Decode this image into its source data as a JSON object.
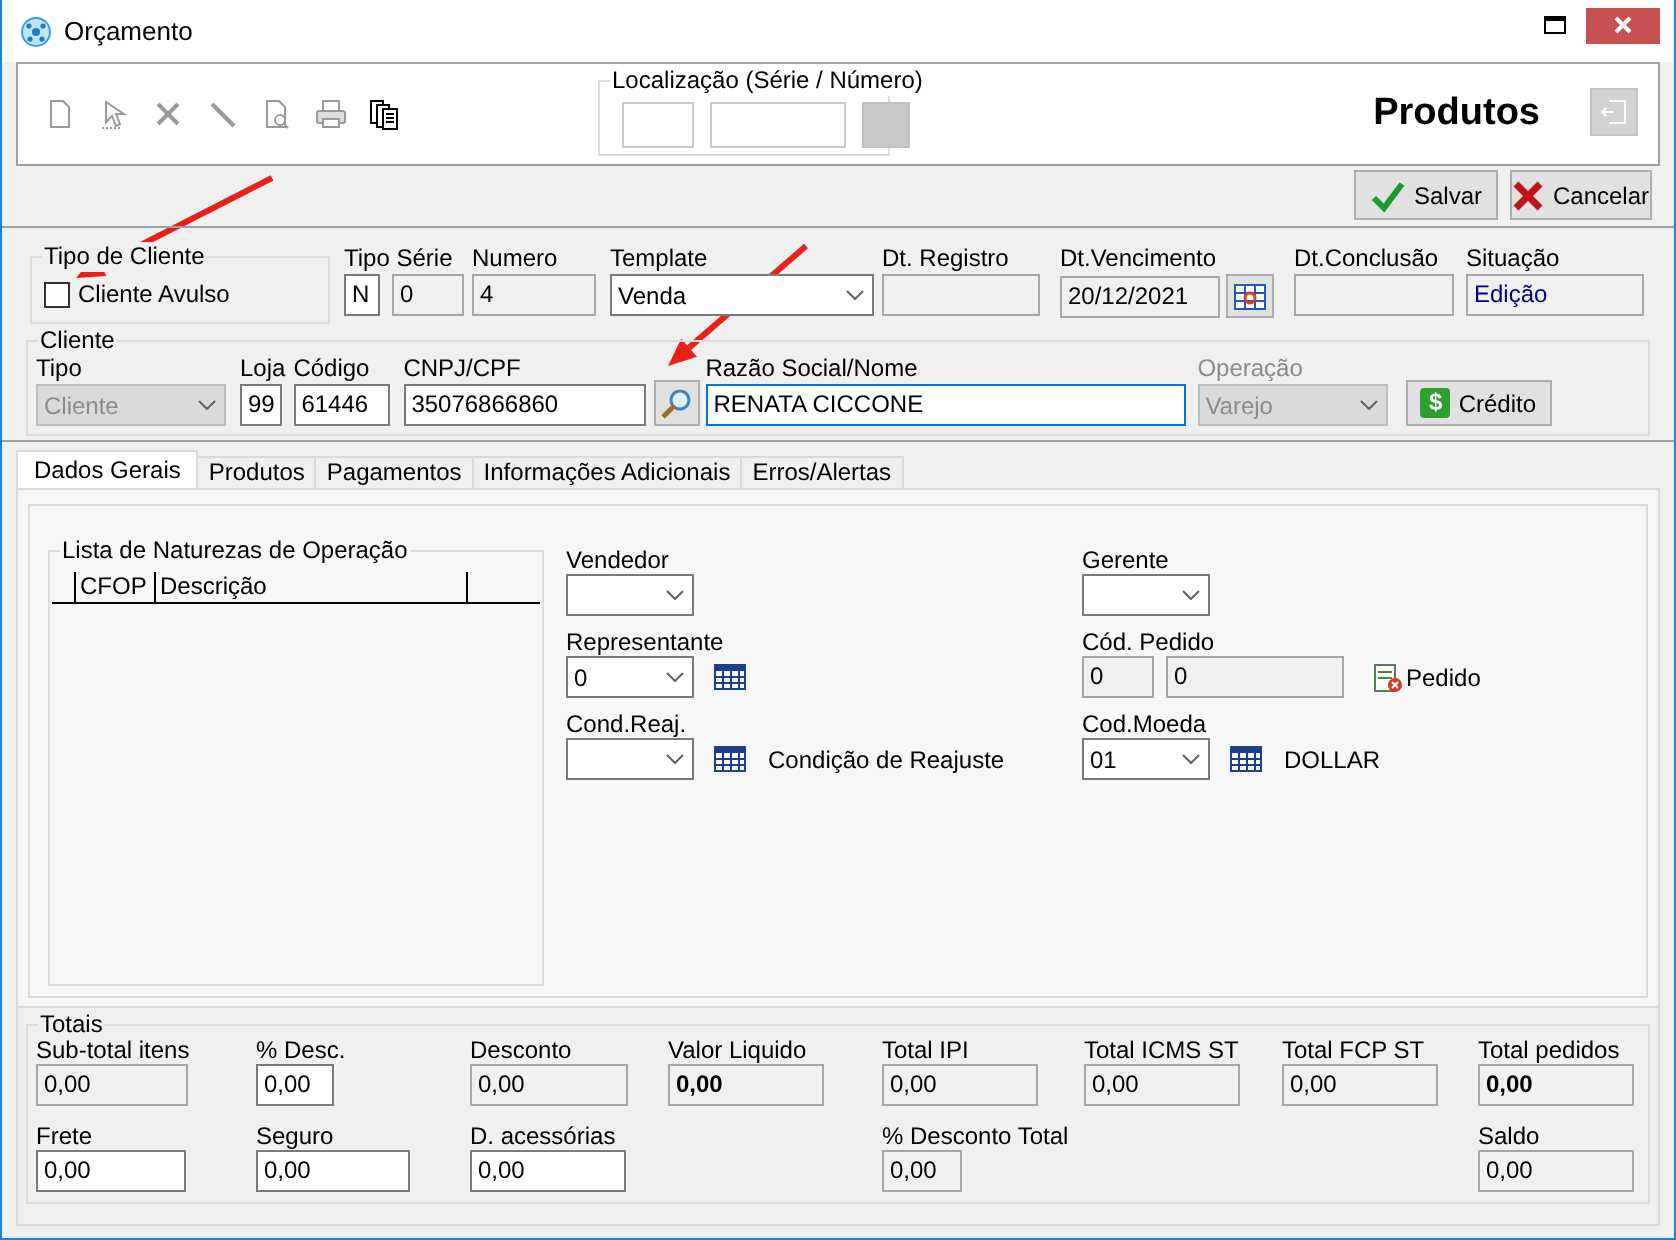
{
  "window": {
    "title": "Orçamento"
  },
  "toolbar": {
    "location_label": "Localização (Série / Número)",
    "screen_title": "Produtos"
  },
  "actions": [
    {
      "kind": "save",
      "label": "Salvar"
    },
    {
      "kind": "cancel",
      "label": "Cancelar"
    }
  ],
  "client_type": {
    "title": "Tipo de Cliente",
    "label": "Cliente Avulso",
    "checked": false
  },
  "header_fields": [
    {
      "label": "Tipo Série",
      "kind": "text",
      "inputs": [
        {
          "value": "N",
          "readonly": false
        },
        {
          "value": "0",
          "readonly": true
        }
      ]
    },
    {
      "label": "Numero",
      "kind": "text",
      "inputs": [
        {
          "value": "4",
          "readonly": true
        }
      ]
    },
    {
      "label": "Template",
      "kind": "combo",
      "inputs": [
        {
          "value": "Venda",
          "disabled": false
        }
      ]
    },
    {
      "label": "Dt. Registro",
      "kind": "text",
      "inputs": [
        {
          "readonly": true
        }
      ]
    },
    {
      "label": "Dt.Vencimento",
      "kind": "date",
      "inputs": [
        {
          "value": "20/12/2021",
          "readonly": true
        }
      ]
    },
    {
      "label": "Dt.Conclusão",
      "kind": "text",
      "inputs": [
        {
          "readonly": true
        }
      ]
    },
    {
      "label": "Situação",
      "kind": "status",
      "inputs": [
        {
          "value": "Edição",
          "readonly": true
        }
      ]
    }
  ],
  "client": {
    "title": "Cliente",
    "fields": [
      {
        "label": "Tipo",
        "kind": "combo",
        "inputs": [
          {
            "value": "Cliente",
            "disabled": true
          }
        ]
      },
      {
        "label": "Loja",
        "kind": "text",
        "inputs": [
          {
            "value": "99",
            "readonly": false
          }
        ]
      },
      {
        "label": "Código",
        "kind": "text",
        "inputs": [
          {
            "value": "61446",
            "readonly": false
          }
        ]
      },
      {
        "label": "CNPJ/CPF",
        "kind": "text",
        "inputs": [
          {
            "value": "35076866860",
            "readonly": false
          }
        ]
      },
      {
        "kind": "search_button"
      },
      {
        "label": "Razão Social/Nome",
        "kind": "text",
        "inputs": [
          {
            "value": "RENATA CICCONE",
            "readonly": false,
            "focused": true
          }
        ]
      },
      {
        "label": "Operação",
        "kind": "combo",
        "dimmed": true,
        "inputs": [
          {
            "value": "Varejo",
            "disabled": true
          }
        ]
      },
      {
        "kind": "button",
        "icon": "$",
        "label": "Crédito"
      }
    ]
  },
  "tabs": [
    {
      "label": "Dados Gerais",
      "selected": true
    },
    {
      "label": "Produtos",
      "selected": false
    },
    {
      "label": "Pagamentos",
      "selected": false
    },
    {
      "label": "Informações Adicionais",
      "selected": false
    },
    {
      "label": "Erros/Alertas",
      "selected": false
    }
  ],
  "general": {
    "naturezas": {
      "title": "Lista de Naturezas de Operação",
      "columns": [
        "CFOP",
        "Descrição"
      ]
    },
    "left_fields": [
      {
        "label": "Vendedor",
        "kind": "combo",
        "inputs": [
          {
            "disabled": false
          }
        ]
      },
      {
        "label": "Representante",
        "kind": "combo",
        "lookup": true,
        "inputs": [
          {
            "value": "0",
            "disabled": false
          }
        ]
      },
      {
        "label": "Cond.Reaj.",
        "kind": "combo",
        "lookup": true,
        "note": "Condição de Reajuste",
        "inputs": [
          {
            "disabled": false
          }
        ]
      }
    ],
    "right_fields": [
      {
        "label": "Gerente",
        "kind": "combo",
        "inputs": [
          {
            "disabled": false
          }
        ]
      },
      {
        "label": "Cód. Pedido",
        "kind": "text",
        "action": "Pedido",
        "inputs": [
          {
            "value": "0",
            "readonly": true
          },
          {
            "value": "0",
            "readonly": true
          }
        ]
      },
      {
        "label": "Cod.Moeda",
        "kind": "combo",
        "lookup": true,
        "note": "DOLLAR",
        "inputs": [
          {
            "value": "01",
            "disabled": false
          }
        ]
      }
    ]
  },
  "totals": {
    "title": "Totais",
    "columns": [
      [
        {
          "label": "Sub-total itens",
          "value": "0,00",
          "readonly": true,
          "bold": false
        },
        {
          "label": "Frete",
          "value": "0,00",
          "readonly": false,
          "bold": false
        }
      ],
      [
        {
          "label": "% Desc.",
          "value": "0,00",
          "readonly": false,
          "bold": false
        },
        {
          "label": "Seguro",
          "value": "0,00",
          "readonly": false,
          "bold": false
        }
      ],
      [
        {
          "label": "Desconto",
          "value": "0,00",
          "readonly": true,
          "bold": false
        },
        {
          "label": "D. acessórias",
          "value": "0,00",
          "readonly": false,
          "bold": false
        }
      ],
      [
        {
          "label": "Valor Liquido",
          "value": "0,00",
          "readonly": true,
          "bold": true
        }
      ],
      [
        {
          "label": "Total IPI",
          "value": "0,00",
          "readonly": true,
          "bold": false
        },
        {
          "label": "% Desconto Total",
          "value": "0,00",
          "readonly": true,
          "bold": false
        }
      ],
      [
        {
          "label": "Total ICMS ST",
          "value": "0,00",
          "readonly": true,
          "bold": false
        }
      ],
      [
        {
          "label": "Total FCP ST",
          "value": "0,00",
          "readonly": true,
          "bold": false
        }
      ],
      [
        {
          "label": "Total pedidos",
          "value": "0,00",
          "readonly": true,
          "bold": true
        },
        {
          "label": "Saldo",
          "value": "0,00",
          "readonly": true,
          "bold": false
        }
      ]
    ]
  }
}
